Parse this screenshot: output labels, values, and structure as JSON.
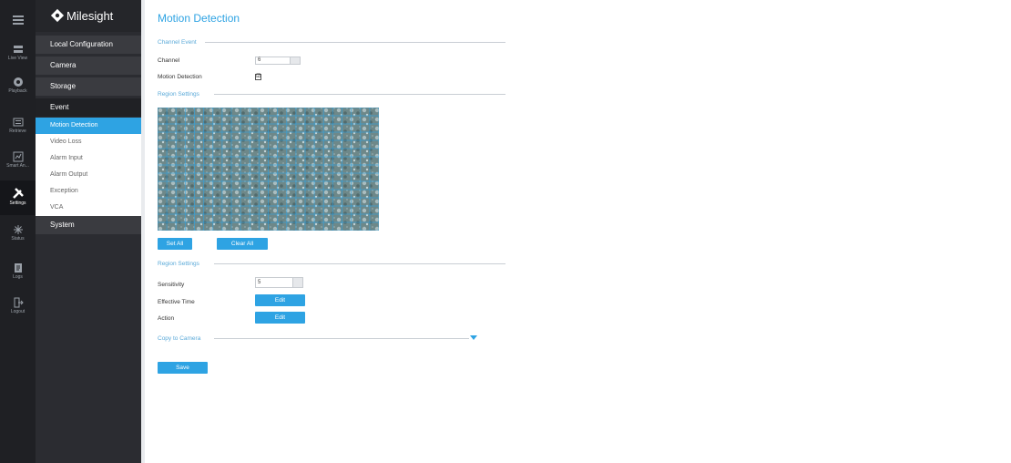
{
  "iconbar": {
    "items": [
      {
        "label": "",
        "icon": "menu-toggle-icon"
      },
      {
        "label": "Live View",
        "icon": "live-view-icon"
      },
      {
        "label": "Playback",
        "icon": "playback-icon"
      },
      {
        "label": "Retrieve",
        "icon": "retrieve-icon"
      },
      {
        "label": "Smart An...",
        "icon": "smart-analysis-icon"
      },
      {
        "label": "Settings",
        "icon": "settings-icon"
      },
      {
        "label": "Status",
        "icon": "status-icon"
      },
      {
        "label": "Logs",
        "icon": "logs-icon"
      },
      {
        "label": "Logout",
        "icon": "logout-icon"
      }
    ]
  },
  "sidebar": {
    "brand": "Milesight",
    "menu": [
      "Local Configuration",
      "Camera",
      "Storage",
      "Event",
      "System"
    ],
    "event_submenu": [
      "Motion Detection",
      "Video Loss",
      "Alarm Input",
      "Alarm Output",
      "Exception",
      "VCA"
    ]
  },
  "main": {
    "title": "Motion Detection",
    "channel_event": "Channel Event",
    "channel_label": "Channel",
    "channel_value": "6",
    "motion_label": "Motion Detection",
    "motion_checked": "☑",
    "region_settings_1": "Region Settings",
    "set_all": "Set All",
    "clear_all": "Clear All",
    "region_settings_2": "Region Settings",
    "sensitivity_label": "Sensitivity",
    "sensitivity_value": "5",
    "effective_time_label": "Effective Time",
    "action_label": "Action",
    "edit_label": "Edit",
    "copy_to_camera": "Copy to Camera",
    "save": "Save"
  },
  "colors": {
    "accent": "#2ea3e3",
    "sidebar_bg": "#2b2c31",
    "iconbar_bg": "#1f2024"
  }
}
